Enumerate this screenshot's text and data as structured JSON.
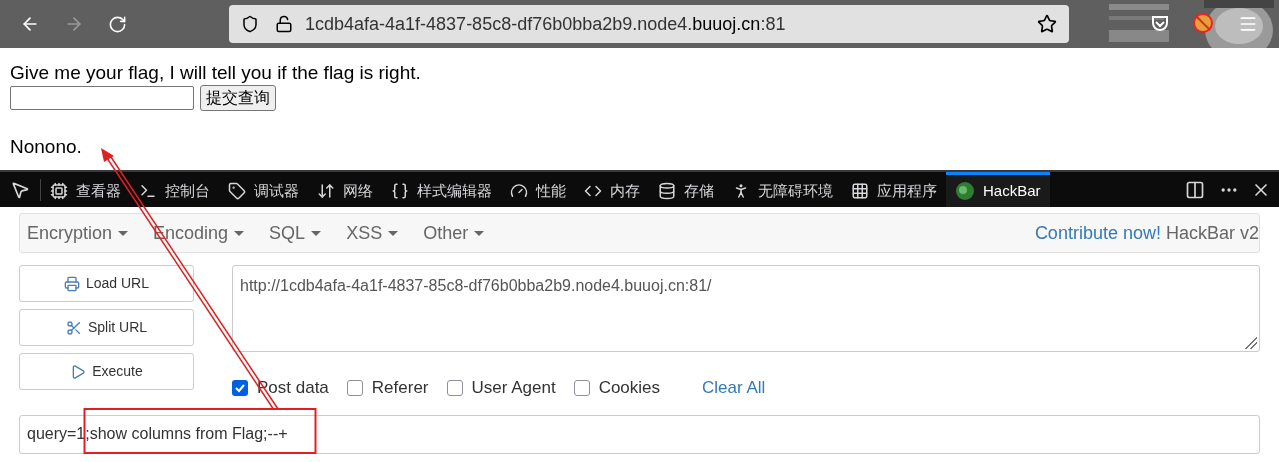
{
  "browser": {
    "url_host": "1cdb4afa-4a1f-4837-85c8-df76b0bba2b9.node4.",
    "url_domain": "buuoj.cn",
    "url_port": ":81"
  },
  "page": {
    "prompt": "Give me your flag, I will tell you if the flag is right.",
    "submit": "提交查询",
    "result": "Nonono."
  },
  "devtools_tabs": [
    {
      "label": "查看器",
      "selected": false
    },
    {
      "label": "控制台",
      "selected": false
    },
    {
      "label": "调试器",
      "selected": false
    },
    {
      "label": "网络",
      "selected": false
    },
    {
      "label": "样式编辑器",
      "selected": false
    },
    {
      "label": "性能",
      "selected": false
    },
    {
      "label": "内存",
      "selected": false
    },
    {
      "label": "存储",
      "selected": false
    },
    {
      "label": "无障碍环境",
      "selected": false
    },
    {
      "label": "应用程序",
      "selected": false
    },
    {
      "label": "HackBar",
      "selected": true
    }
  ],
  "hackbar": {
    "menus": [
      "Encryption",
      "Encoding",
      "SQL",
      "XSS",
      "Other"
    ],
    "contribute": "Contribute now!",
    "version": "HackBar v2",
    "buttons": [
      "Load URL",
      "Split URL",
      "Execute"
    ],
    "url": "http://1cdb4afa-4a1f-4837-85c8-df76b0bba2b9.node4.buuoj.cn:81/",
    "options": [
      {
        "label": "Post data",
        "checked": true
      },
      {
        "label": "Referer",
        "checked": false
      },
      {
        "label": "User Agent",
        "checked": false
      },
      {
        "label": "Cookies",
        "checked": false
      }
    ],
    "clear": "Clear All",
    "post_body": "query=1;show columns from Flag;--+"
  }
}
